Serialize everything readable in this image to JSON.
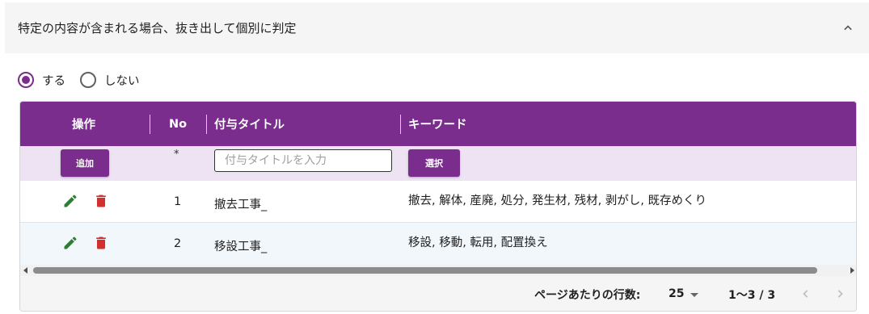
{
  "panel": {
    "title": "特定の内容が含まれる場合、抜き出して個別に判定",
    "expanded": true
  },
  "radio": {
    "options": [
      {
        "label": "する",
        "checked": true
      },
      {
        "label": "しない",
        "checked": false
      }
    ]
  },
  "table": {
    "columns": {
      "action": "操作",
      "no": "No",
      "title": "付与タイトル",
      "keyword": "キーワード"
    },
    "add_row": {
      "add_label": "追加",
      "no": "*",
      "title_placeholder": "付与タイトルを入力",
      "select_label": "選択"
    },
    "rows": [
      {
        "no": "1",
        "title": "撤去工事_",
        "keywords": "撤去, 解体, 産廃, 処分, 発生材, 残材, 剥がし, 既存めくり"
      },
      {
        "no": "2",
        "title": "移設工事_",
        "keywords": "移設, 移動, 転用, 配置換え"
      }
    ]
  },
  "pagination": {
    "rows_per_page_label": "ページあたりの行数:",
    "rows_per_page_value": "25",
    "range": "1〜3 / 3"
  },
  "colors": {
    "accent": "#7b2d8e",
    "edit_icon": "#2e7d32",
    "delete_icon": "#d32f2f",
    "add_row_bg": "#ede3f2"
  }
}
